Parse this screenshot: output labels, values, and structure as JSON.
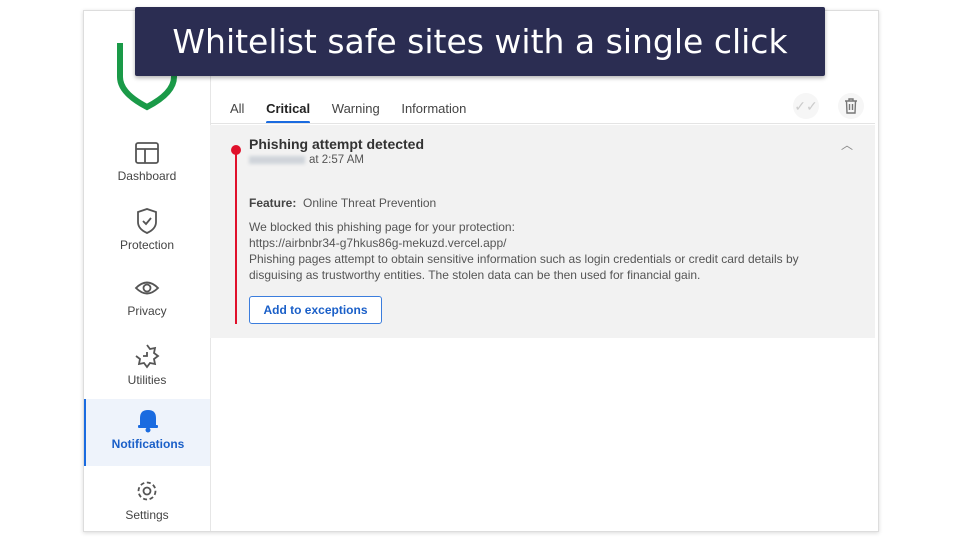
{
  "banner": "Whitelist safe sites with a single click",
  "sidebar": {
    "items": [
      {
        "label": "Dashboard",
        "icon": "dashboard-icon"
      },
      {
        "label": "Protection",
        "icon": "shield-check-icon"
      },
      {
        "label": "Privacy",
        "icon": "eye-icon"
      },
      {
        "label": "Utilities",
        "icon": "utilities-icon"
      },
      {
        "label": "Notifications",
        "icon": "bell-icon",
        "selected": true
      },
      {
        "label": "Settings",
        "icon": "gear-icon"
      }
    ]
  },
  "tabs": [
    "All",
    "Critical",
    "Warning",
    "Information"
  ],
  "active_tab": "Critical",
  "notification": {
    "title": "Phishing attempt detected",
    "time": "at 2:57 AM",
    "feature_label": "Feature:",
    "feature_value": "Online Threat Prevention",
    "line1": "We blocked this phishing page for your protection:",
    "url": "https://airbnbr34-g7hkus86g-mekuzd.vercel.app/",
    "line2": "Phishing pages attempt to obtain sensitive information such as login credentials or credit card details by disguising as trustworthy entities. The stolen data can be then used for financial gain.",
    "button": "Add to exceptions"
  },
  "colors": {
    "accent": "#1a6be0",
    "critical": "#e0112b",
    "banner": "#2b2d52",
    "logo": "#1a9a48"
  }
}
